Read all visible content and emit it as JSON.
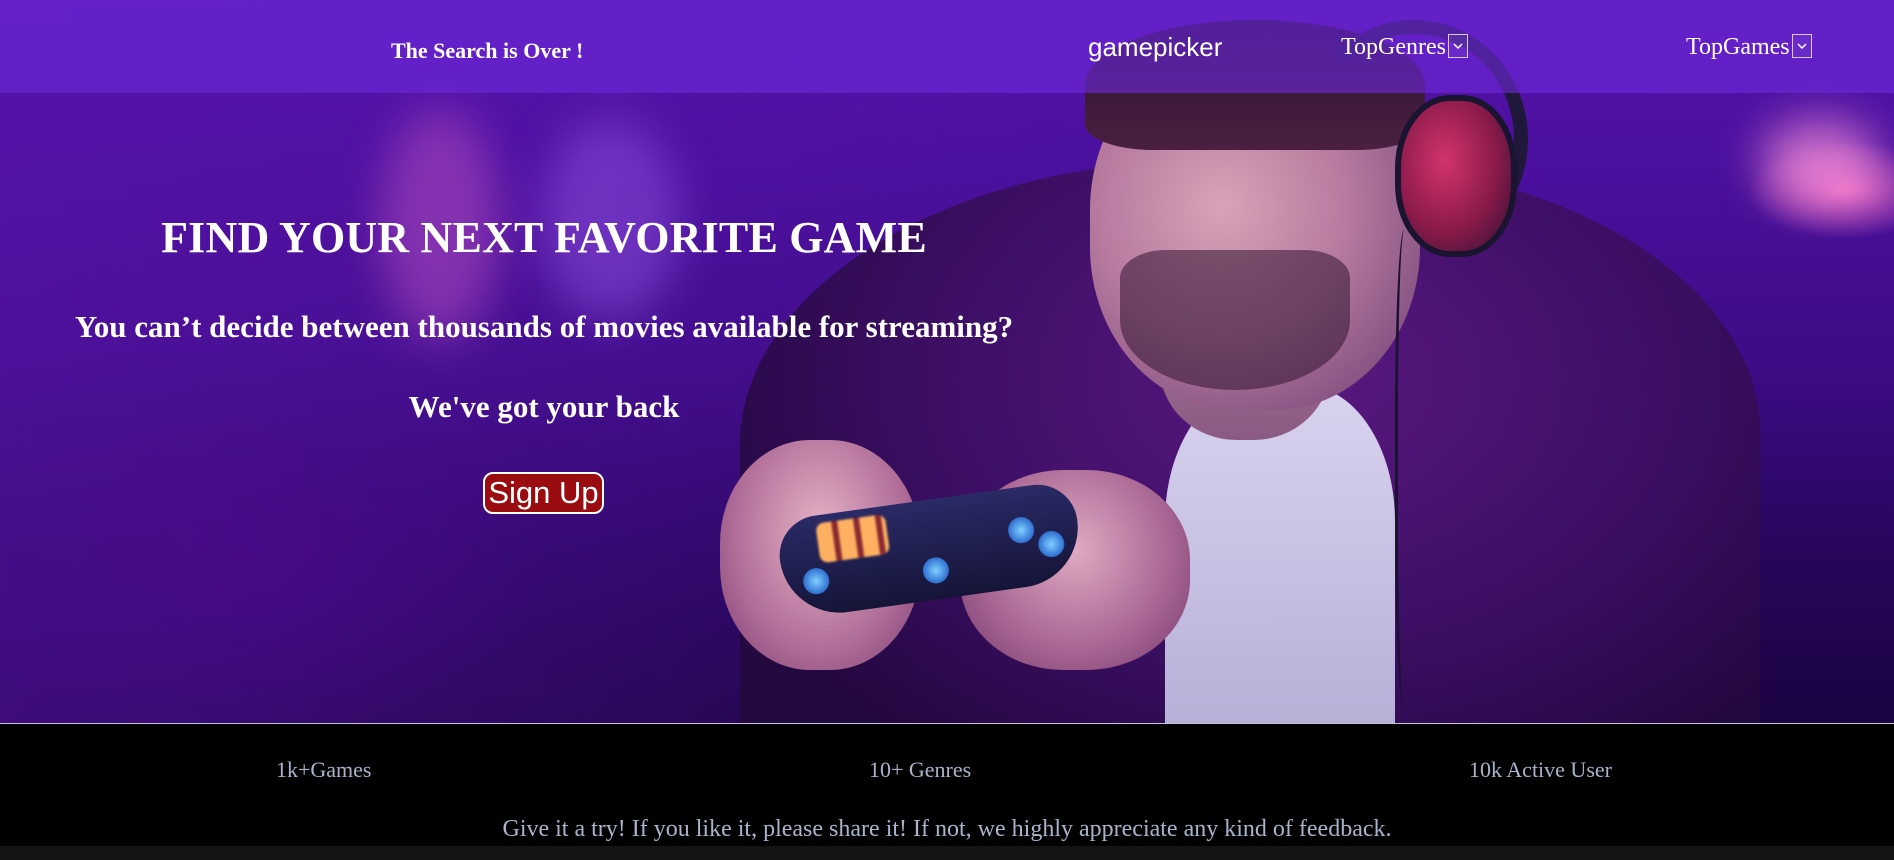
{
  "navbar": {
    "tagline": "The Search is Over !",
    "brand": "gamepicker",
    "menus": [
      {
        "label": "TopGenres",
        "icon": "chevron-down-icon"
      },
      {
        "label": "TopGames",
        "icon": "chevron-down-icon"
      }
    ]
  },
  "hero": {
    "title": "FIND YOUR NEXT FAVORITE GAME",
    "subtitle": "You can’t decide between thousands of movies available for streaming?",
    "tagline": "We've got your back",
    "cta_label": "Sign Up",
    "background_image": "person-with-headphones-holding-game-controller"
  },
  "stats": {
    "items": [
      "1k+Games",
      "10+ Genres",
      "10k Active User"
    ],
    "feedback": "Give it a try! If you like it, please share it! If not, we highly appreciate any kind of feedback."
  },
  "colors": {
    "navbar": "#6e28dc",
    "cta_background": "#9a0c10",
    "stats_background": "#000000",
    "stats_text": "#a9b3cc",
    "hero_text": "#ffffff"
  }
}
